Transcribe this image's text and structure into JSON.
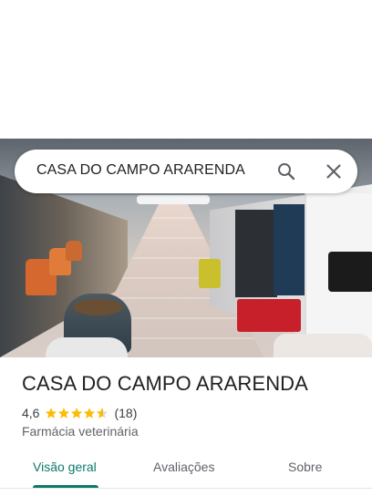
{
  "search": {
    "query": "CASA DO CAMPO ARARENDA",
    "search_icon": "search-icon",
    "close_icon": "close-icon"
  },
  "place": {
    "title": "CASA DO CAMPO ARARENDA",
    "rating": "4,6",
    "rating_value": 4.6,
    "review_count": "(18)",
    "category": "Farmácia veterinária"
  },
  "tabs": [
    {
      "label": "Visão geral",
      "active": true
    },
    {
      "label": "Avaliações",
      "active": false
    },
    {
      "label": "Sobre",
      "active": false
    }
  ],
  "colors": {
    "accent": "#0b7a6b",
    "star": "#fbbc04",
    "text": "#202124",
    "muted": "#5f6368"
  }
}
